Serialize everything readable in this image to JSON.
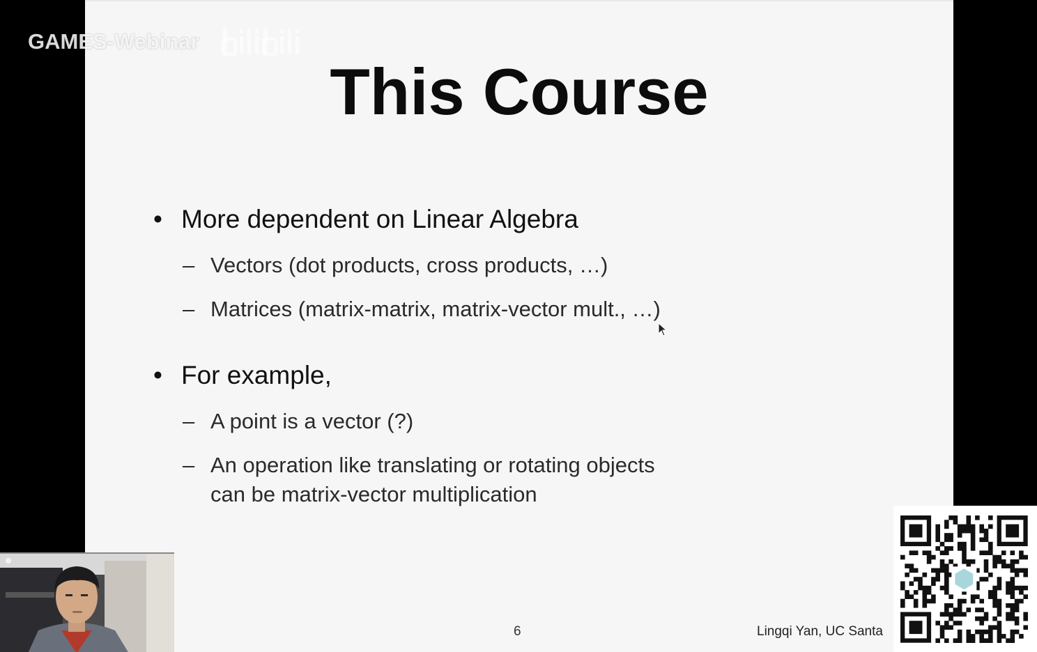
{
  "watermark": {
    "channel_text": "GAMES-Webinar",
    "logo_name": "bilibili-logo"
  },
  "slide": {
    "title": "This Course",
    "bullets": [
      {
        "text": "More dependent on Linear Algebra",
        "subitems": [
          "Vectors (dot products, cross products, …)",
          "Matrices (matrix-matrix, matrix-vector mult., …)"
        ]
      },
      {
        "text": "For example,",
        "subitems": [
          "A point is a vector (?)",
          "An operation like translating or rotating objects",
          "can be matrix-vector multiplication"
        ]
      }
    ],
    "bullet_glyph": "•",
    "dash_glyph": "–",
    "page_number": "6",
    "footer": "Lingqi Yan, UC Santa"
  },
  "overlays": {
    "webcam_name": "presenter-webcam",
    "qr_name": "qr-code"
  },
  "colors": {
    "slide_background": "#f6f6f6",
    "frame": "#000000",
    "title": "#0c0c0c"
  }
}
